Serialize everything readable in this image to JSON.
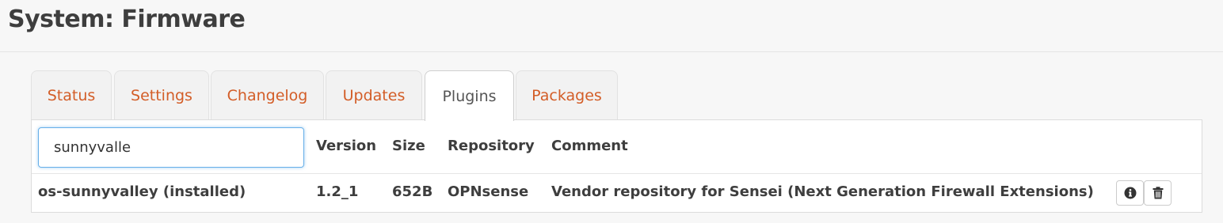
{
  "page": {
    "title": "System: Firmware"
  },
  "tabs": [
    {
      "label": "Status"
    },
    {
      "label": "Settings"
    },
    {
      "label": "Changelog"
    },
    {
      "label": "Updates"
    },
    {
      "label": "Plugins",
      "active": true
    },
    {
      "label": "Packages"
    }
  ],
  "search": {
    "value": "sunnyvalle",
    "placeholder": ""
  },
  "table": {
    "columns": [
      "Version",
      "Size",
      "Repository",
      "Comment"
    ],
    "rows": [
      {
        "name": "os-sunnyvalley (installed)",
        "version": "1.2_1",
        "size": "652B",
        "repository": "OPNsense",
        "comment": "Vendor repository for Sensei (Next Generation Firewall Extensions)",
        "actions": [
          "info-icon",
          "trash-icon"
        ]
      }
    ]
  },
  "colors": {
    "accent": "#d35d27",
    "focus": "#66afe9"
  }
}
